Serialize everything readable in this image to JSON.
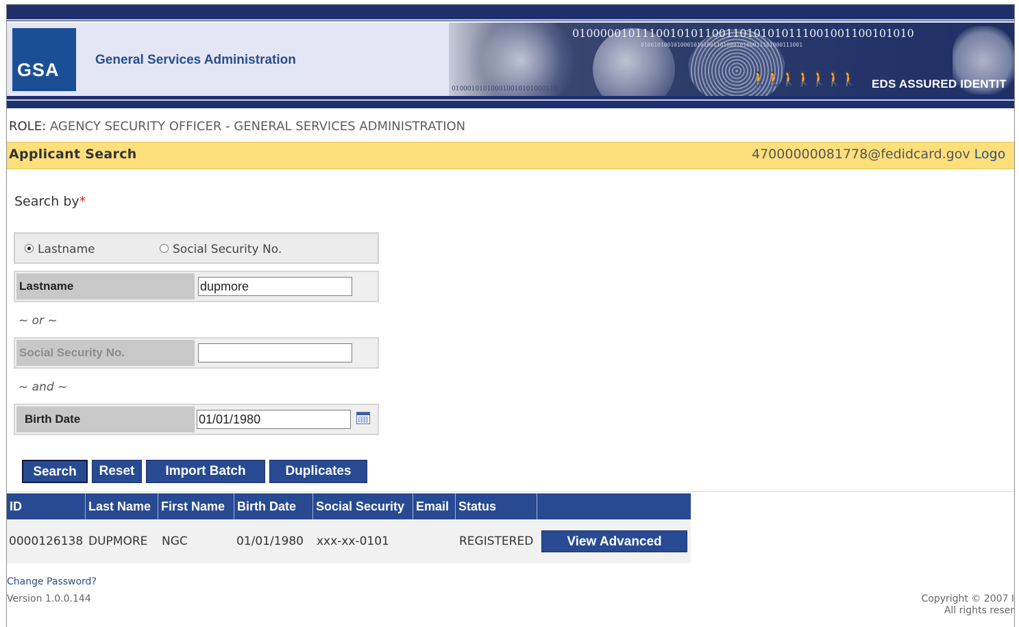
{
  "header": {
    "logo_text": "GSA",
    "agency_name": "General Services Administration",
    "banner_text": "EDS ASSURED IDENTIT",
    "banner_bits_top": "0100000101110010101100110101010111001001100101010",
    "banner_bits_small": "0100101001010001010100110100010100011101000111001",
    "banner_bits_bottom": "010001010100010010101000110"
  },
  "role": {
    "key": "ROLE:",
    "value": "AGENCY SECURITY OFFICER - GENERAL SERVICES ADMINISTRATION"
  },
  "title_bar": {
    "title": "Applicant Search",
    "user_email": "47000000081778@fedidcard.gov",
    "logout_label": "Logo"
  },
  "search": {
    "search_by_label": "Search by",
    "required_marker": "*",
    "radio_lastname": "Lastname",
    "radio_ssn": "Social Security No.",
    "selected": "Lastname",
    "lastname_label": "Lastname",
    "lastname_value": "dupmore",
    "or_text": "~ or ~",
    "ssn_label": "Social Security No.",
    "ssn_value": "",
    "and_text": "~ and ~",
    "birthdate_label": "Birth Date",
    "birthdate_value": "01/01/1980"
  },
  "buttons": {
    "search": "Search",
    "reset": "Reset",
    "import_batch": "Import Batch",
    "duplicates": "Duplicates"
  },
  "results": {
    "columns": [
      "ID",
      "Last Name",
      "First Name",
      "Birth Date",
      "Social Security",
      "Email",
      "Status",
      ""
    ],
    "rows": [
      {
        "id": "0000126138",
        "last_name": "DUPMORE",
        "first_name": "NGC",
        "birth_date": "01/01/1980",
        "social_security": "xxx-xx-0101",
        "email": "",
        "status": "REGISTERED",
        "action": "View Advanced"
      }
    ]
  },
  "footer": {
    "change_password": "Change Password?",
    "version": "Version 1.0.0.144",
    "copyright_line1": "Copyright © 2007 I",
    "copyright_line2": "All rights reser"
  },
  "colors": {
    "nav_blue": "#1f2f6b",
    "button_blue": "#284a93",
    "title_bar_yellow": "#fddf7b",
    "logo_blue": "#1a4f95",
    "required_red": "#d42020"
  }
}
